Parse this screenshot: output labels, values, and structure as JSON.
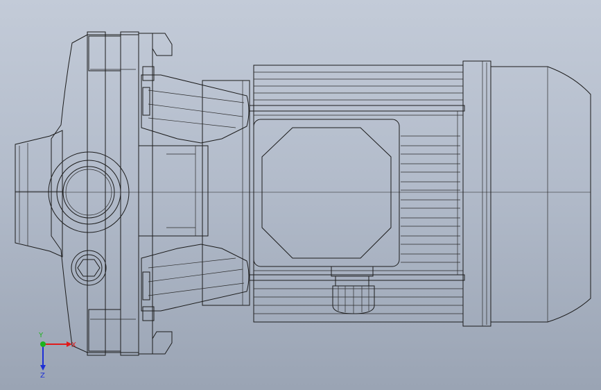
{
  "viewport": {
    "background_top": "#c3cbd8",
    "background_bottom": "#9aa4b4"
  },
  "model": {
    "body_color": "#ededea",
    "shade_color": "#cfcfcb",
    "line_color": "#1b1b1b"
  },
  "triad": {
    "x_label": "X",
    "y_label": "Y",
    "z_label": "Z",
    "x_color": "#e01b1b",
    "y_color": "#1db31d",
    "z_color": "#1d2fd6"
  }
}
